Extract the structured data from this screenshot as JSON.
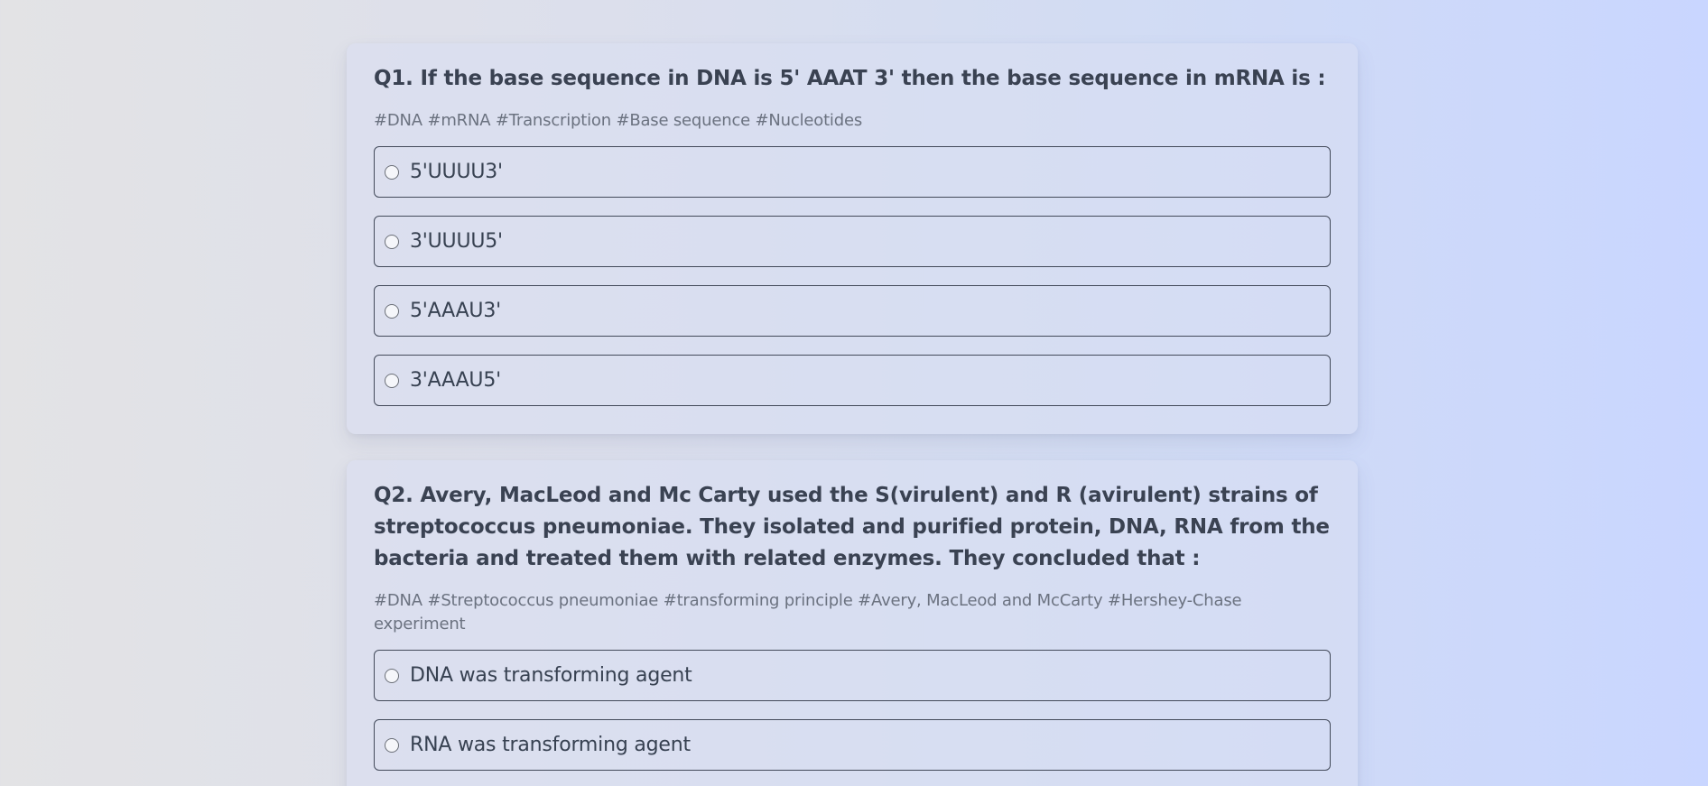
{
  "questions": [
    {
      "title": "Q1. If the base sequence in DNA is 5' AAAT 3' then the base sequence in mRNA is :",
      "tags": "#DNA #mRNA #Transcription #Base sequence #Nucleotides",
      "options": [
        "5'UUUU3'",
        "3'UUUU5'",
        "5'AAAU3'",
        "3'AAAU5'"
      ]
    },
    {
      "title": "Q2. Avery, MacLeod and Mc Carty used the S(virulent) and R (avirulent) strains of streptococcus pneumoniae. They isolated and purified protein, DNA, RNA from the bacteria and treated them with related enzymes. They concluded that :",
      "tags": "#DNA #Streptococcus pneumoniae #transforming principle #Avery, MacLeod and McCarty #Hershey-Chase experiment",
      "options": [
        "DNA was transforming agent",
        "RNA was transforming agent"
      ]
    }
  ]
}
